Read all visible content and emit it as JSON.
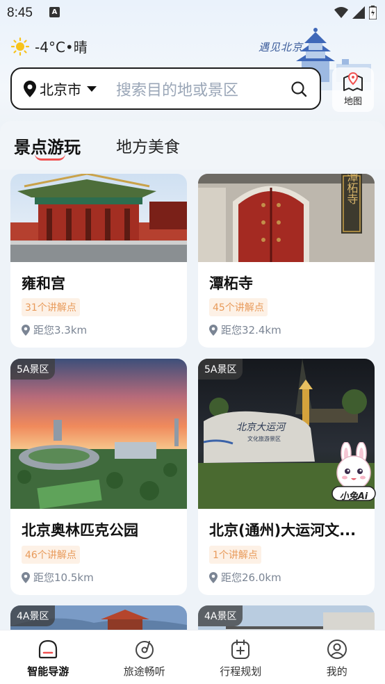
{
  "status_bar": {
    "time": "8:45",
    "notif": "A"
  },
  "weather": {
    "icon": "sun-icon",
    "text": "-4°C•晴"
  },
  "decoration": {
    "text": "遇见北京"
  },
  "search": {
    "city": "北京市",
    "placeholder": "搜索目的地或景区"
  },
  "map_button": {
    "label": "地图"
  },
  "tabs": [
    {
      "label": "景点游玩",
      "active": true
    },
    {
      "label": "地方美食",
      "active": false
    }
  ],
  "cards": [
    {
      "title": "雍和宫",
      "badge": "",
      "tag": "31个讲解点",
      "distance": "距您3.3km"
    },
    {
      "title": "潭柘寺",
      "badge": "",
      "tag": "45个讲解点",
      "distance": "距您32.4km",
      "sign": "潭柘寺"
    },
    {
      "title": "北京奥林匹克公园",
      "badge": "5A景区",
      "tag": "46个讲解点",
      "distance": "距您10.5km"
    },
    {
      "title": "北京(通州)大运河文...",
      "badge": "5A景区",
      "tag": "1个讲解点",
      "distance": "距您26.0km",
      "stone_text": "北京大运河",
      "stone_sub": "文化旅游景区"
    },
    {
      "badge": "4A景区"
    },
    {
      "badge": "4A景区"
    }
  ],
  "mascot": {
    "label": "小兔Ai"
  },
  "bottom_nav": [
    {
      "label": "智能导游",
      "icon": "home-icon",
      "active": true
    },
    {
      "label": "旅途畅听",
      "icon": "music-disc-icon",
      "active": false
    },
    {
      "label": "行程规划",
      "icon": "calendar-plus-icon",
      "active": false
    },
    {
      "label": "我的",
      "icon": "user-icon",
      "active": false
    }
  ],
  "colors": {
    "accent": "#f05050",
    "tag_text": "#e89a5a",
    "tag_bg": "#fdf1e6"
  }
}
